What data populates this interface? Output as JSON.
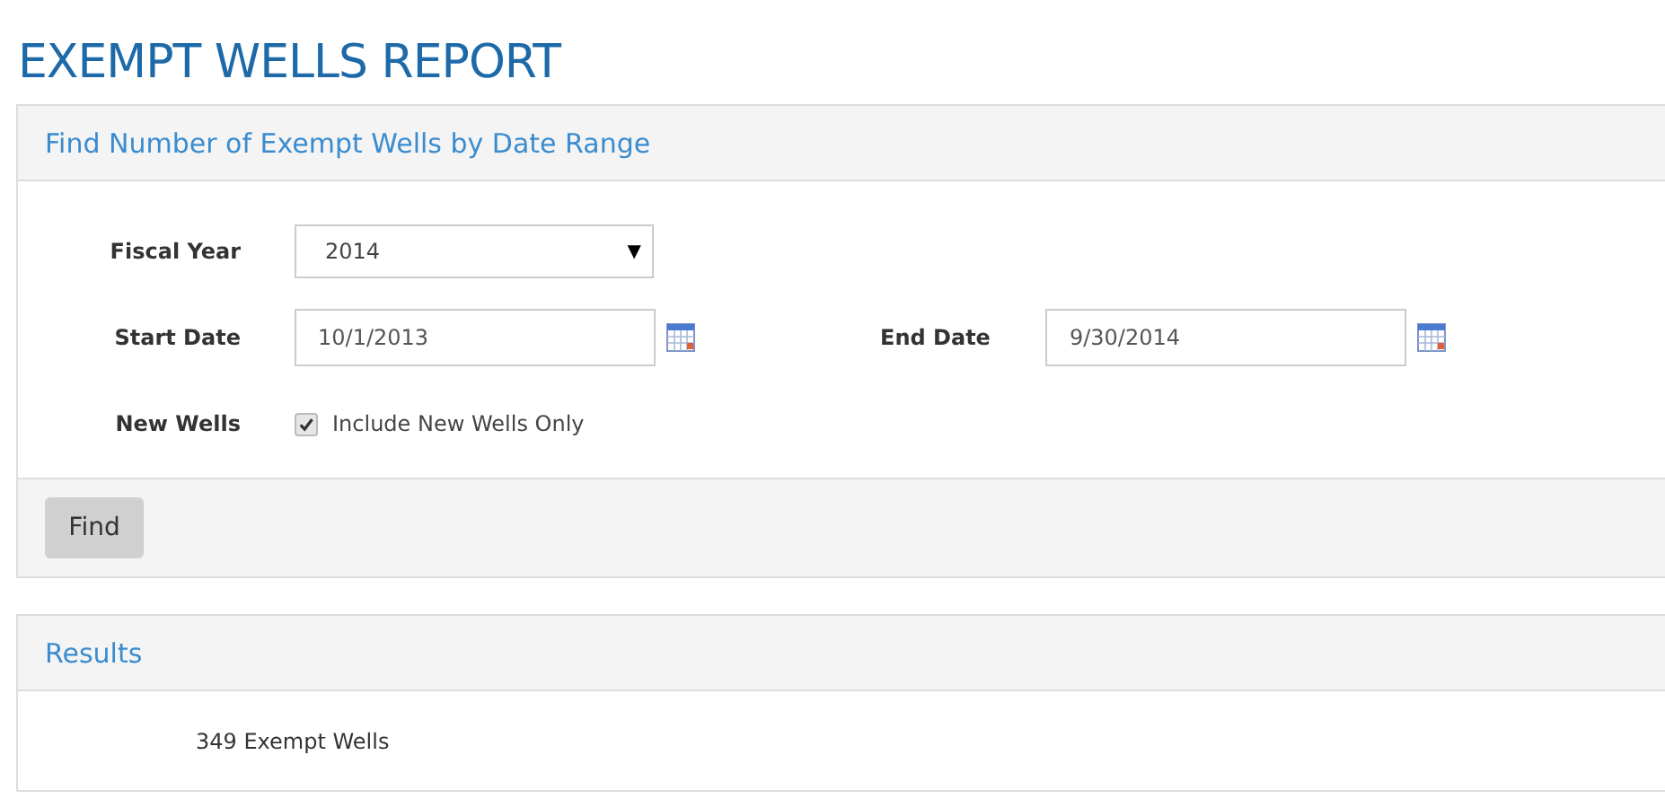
{
  "page_title": "EXEMPT WELLS REPORT",
  "search_panel": {
    "title": "Find Number of Exempt Wells by Date Range",
    "fiscal_year": {
      "label": "Fiscal Year",
      "value": "2014",
      "arrow": "▼"
    },
    "start_date": {
      "label": "Start Date",
      "value": "10/1/2013"
    },
    "end_date": {
      "label": "End Date",
      "value": "9/30/2014"
    },
    "new_wells": {
      "label": "New Wells",
      "option": "Include New Wells Only",
      "checked": true
    },
    "button": "Find"
  },
  "results_panel": {
    "title": "Results",
    "result": "349 Exempt Wells"
  }
}
